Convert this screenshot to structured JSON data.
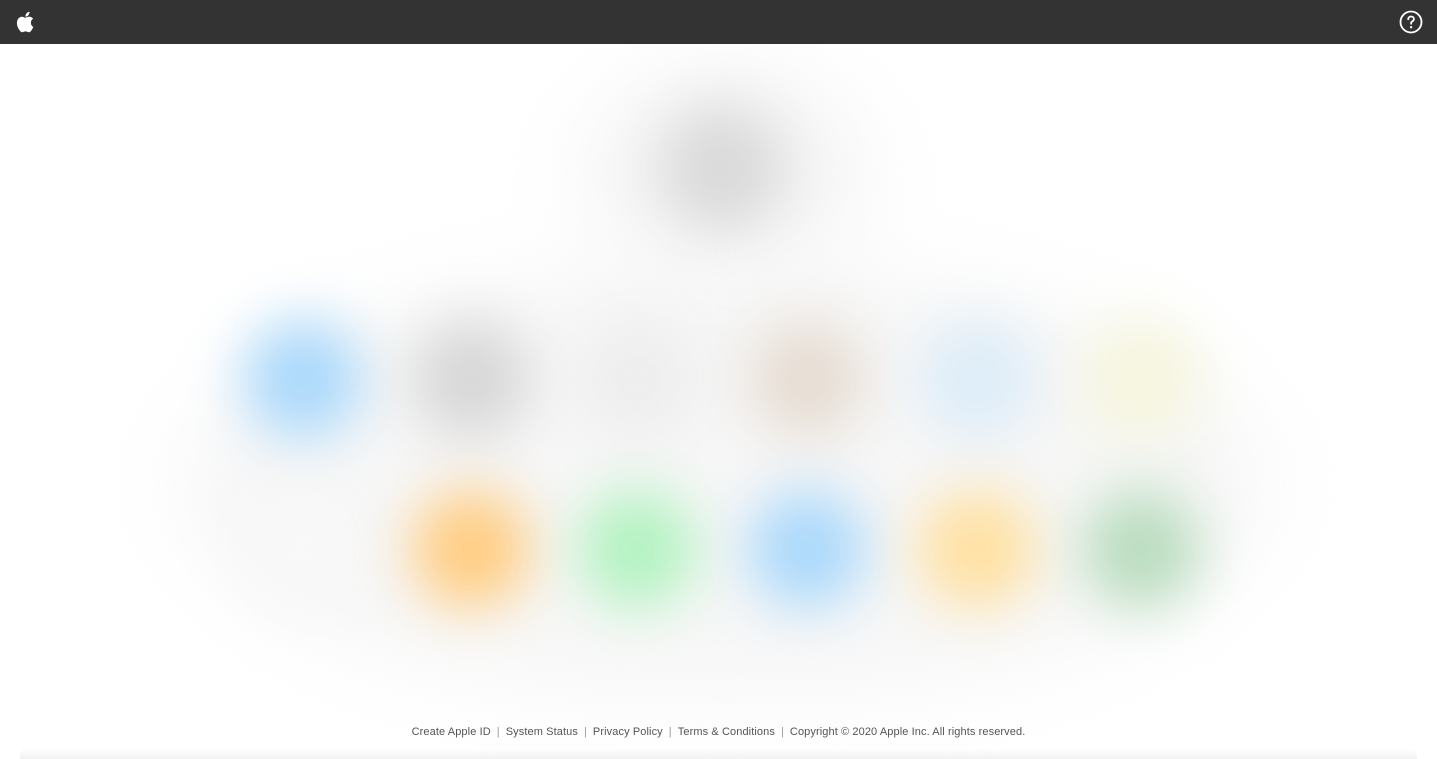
{
  "header": {
    "logo_icon": "apple-logo-icon",
    "help_icon": "help-question-icon"
  },
  "content": {
    "avatar_color": "#d9d9d9",
    "app_tiles": [
      {
        "name": "mail-tile",
        "color": "#a9d8fb"
      },
      {
        "name": "contacts-tile",
        "color": "#d6d6d6"
      },
      {
        "name": "calendar-tile",
        "color": "#ededed"
      },
      {
        "name": "photos-tile",
        "color": "#e6dcd2"
      },
      {
        "name": "icloud-drive-tile",
        "color": "#dcecf8"
      },
      {
        "name": "notes-tile",
        "color": "#f6f5dd"
      },
      {
        "name": "reminders-tile",
        "color": "#f8f8f8"
      },
      {
        "name": "pages-tile",
        "color": "#ffcc80"
      },
      {
        "name": "numbers-tile",
        "color": "#b2f2c0"
      },
      {
        "name": "keynote-tile",
        "color": "#a9d8fb"
      },
      {
        "name": "find-friends-tile",
        "color": "#ffe0a0"
      },
      {
        "name": "find-iphone-tile",
        "color": "#b9dcbe"
      }
    ]
  },
  "footer": {
    "links": [
      "Create Apple ID",
      "System Status",
      "Privacy Policy",
      "Terms & Conditions"
    ],
    "copyright": "Copyright © 2020 Apple Inc. All rights reserved."
  }
}
